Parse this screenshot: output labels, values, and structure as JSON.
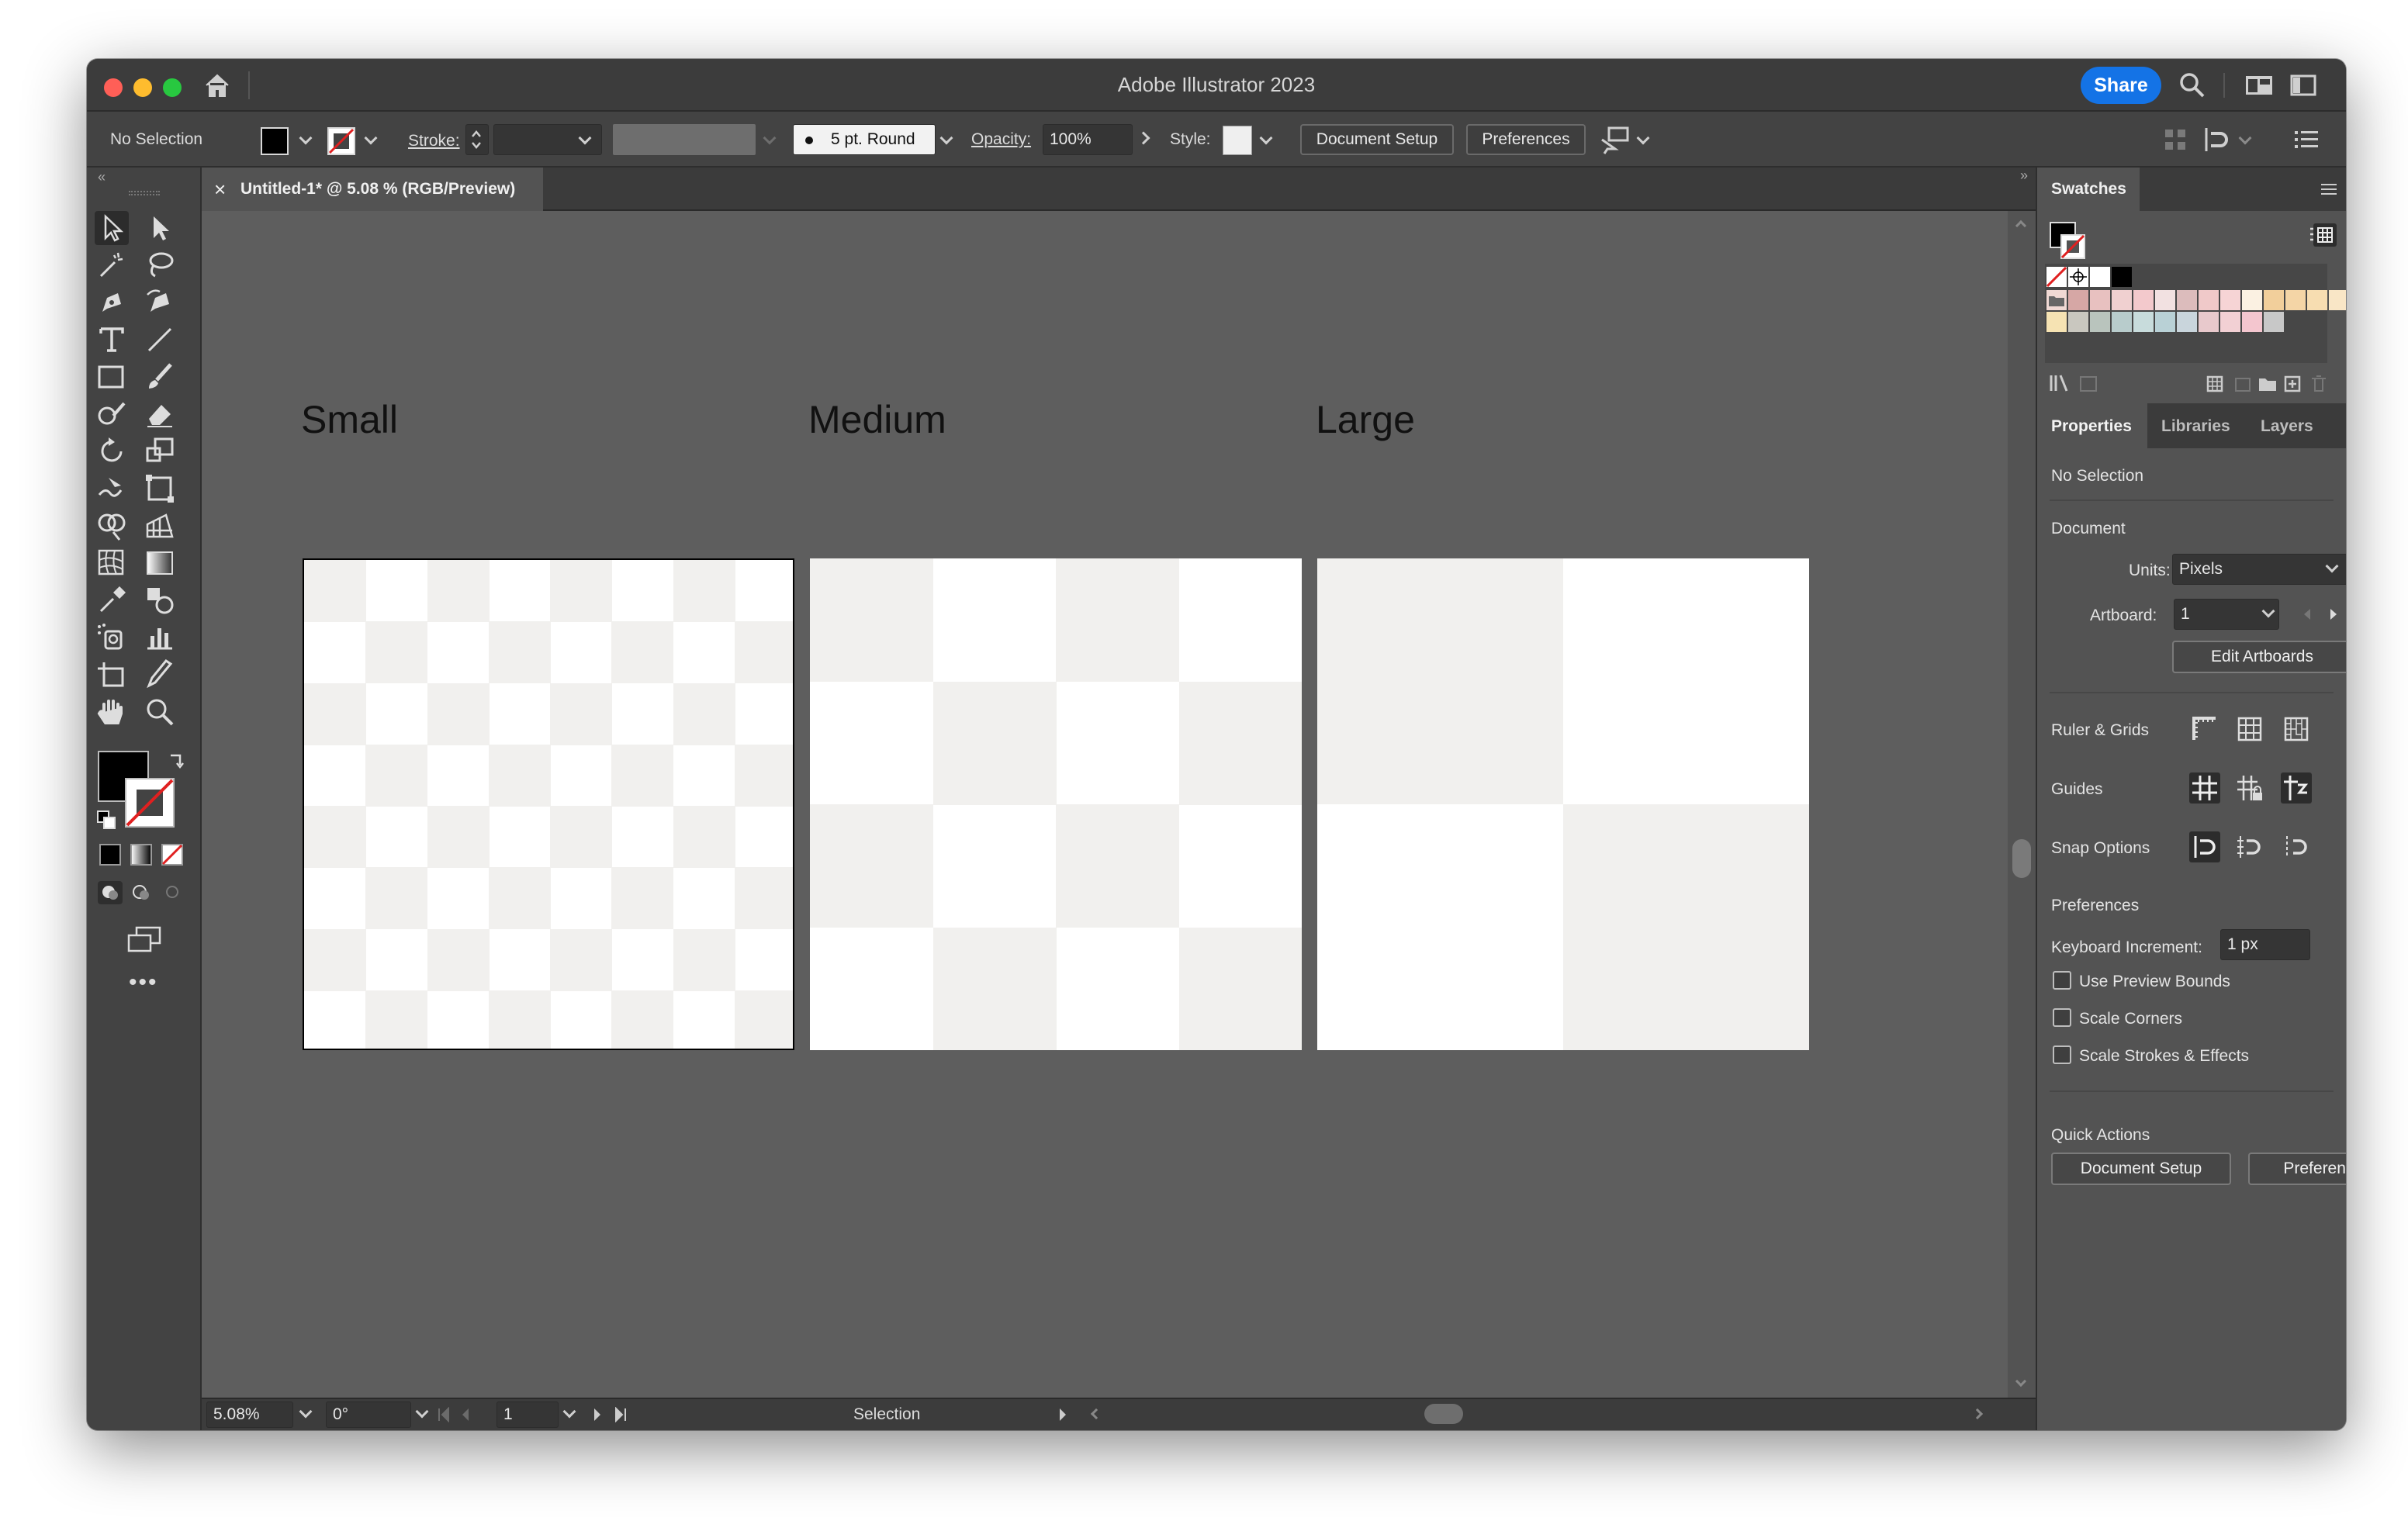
{
  "window": {
    "title": "Adobe Illustrator 2023",
    "share_label": "Share"
  },
  "control_bar": {
    "selection_label": "No Selection",
    "stroke_label": "Stroke:",
    "brush_label": "5 pt. Round",
    "opacity_label": "Opacity:",
    "opacity_value": "100%",
    "style_label": "Style:",
    "document_setup_label": "Document Setup",
    "preferences_label": "Preferences"
  },
  "document_tab": {
    "close_glyph": "×",
    "title": "Untitled-1* @ 5.08 % (RGB/Preview)"
  },
  "artboards": [
    {
      "label": "Small",
      "grid": 8
    },
    {
      "label": "Medium",
      "grid": 4
    },
    {
      "label": "Large",
      "grid": 2
    }
  ],
  "status_bar": {
    "zoom": "5.08%",
    "rotation": "0°",
    "artboard": "1",
    "tool": "Selection"
  },
  "swatches_panel": {
    "title": "Swatches"
  },
  "panel_tabs": {
    "properties": "Properties",
    "libraries": "Libraries",
    "layers": "Layers"
  },
  "properties": {
    "selection": "No Selection",
    "document_heading": "Document",
    "units_label": "Units:",
    "units_value": "Pixels",
    "artboard_label": "Artboard:",
    "artboard_value": "1",
    "edit_artboards_label": "Edit Artboards",
    "ruler_grids_label": "Ruler & Grids",
    "guides_label": "Guides",
    "snap_options_label": "Snap Options",
    "preferences_heading": "Preferences",
    "keyboard_increment_label": "Keyboard Increment:",
    "keyboard_increment_value": "1 px",
    "use_preview_bounds_label": "Use Preview Bounds",
    "scale_corners_label": "Scale Corners",
    "scale_strokes_label": "Scale Strokes & Effects",
    "quick_actions_heading": "Quick Actions",
    "document_setup_label": "Document Setup",
    "preferences_label": "Preferences"
  },
  "colors": {
    "accent": "#1473e6",
    "close": "#ff5f57",
    "minimize": "#febc2e",
    "zoom": "#28c840",
    "checker": "#f1f0ee",
    "none_red": "#e02020"
  },
  "swatch_colors_row1": [
    "#ffffff",
    "#000000"
  ],
  "swatch_colors_row2": [
    "#d6a7a5",
    "#e8c1c0",
    "#f0d0d0",
    "#f3c9cc",
    "#f2e1e1",
    "#dcbcbc",
    "#f0c9c9",
    "#f6d4d5",
    "#fbf1e2",
    "#f2cf9b",
    "#f4d5a6",
    "#f7ddb1",
    "#f9e6c6",
    "#f5e0b6",
    "#f7d79c",
    "#f6dca8",
    "#f2cf90"
  ],
  "swatch_colors_row3": [
    "#f6e3b3",
    "#c9c7bf",
    "#b9c4bd",
    "#b8cccc",
    "#c8dcdc",
    "#b9d1d6",
    "#c9d5dc",
    "#e8c9cc",
    "#f2d0d4",
    "#f4c6cf",
    "#c8c8c8"
  ]
}
